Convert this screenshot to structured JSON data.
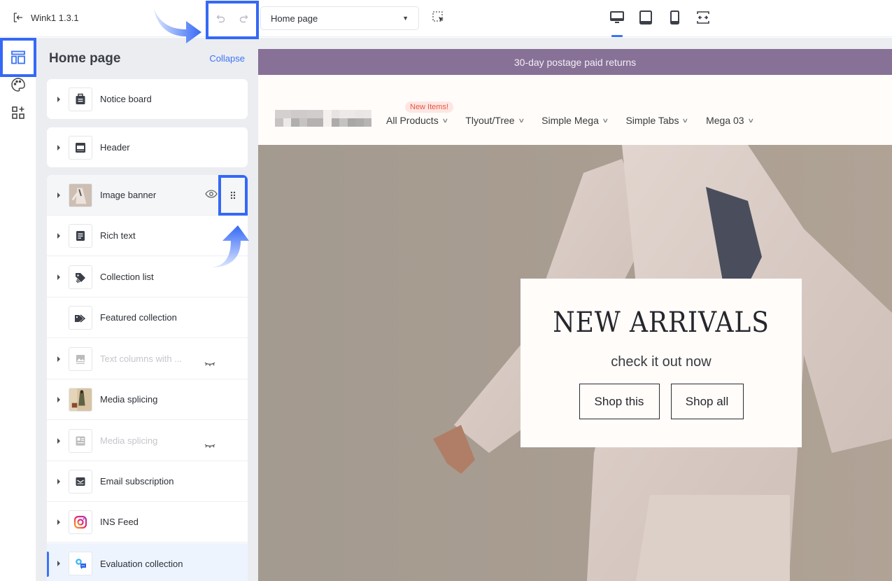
{
  "topbar": {
    "app_name": "Wink1 1.3.1",
    "exit_icon": "exit-icon",
    "undo_icon": "undo-icon",
    "redo_icon": "redo-icon",
    "page_select": {
      "selected": "Home page"
    },
    "select_tool_icon": "element-select-icon",
    "devices": [
      {
        "name": "desktop",
        "icon": "desktop-icon",
        "active": true
      },
      {
        "name": "tablet",
        "icon": "tablet-icon",
        "active": false
      },
      {
        "name": "mobile",
        "icon": "mobile-icon",
        "active": false
      },
      {
        "name": "fullwidth",
        "icon": "expand-width-icon",
        "active": false
      }
    ]
  },
  "rail": {
    "items": [
      {
        "name": "sections",
        "icon": "layout-icon",
        "active": true
      },
      {
        "name": "theme-settings",
        "icon": "palette-icon",
        "active": false
      },
      {
        "name": "apps",
        "icon": "add-block-icon",
        "active": false
      }
    ]
  },
  "sidebar": {
    "title": "Home page",
    "collapse_label": "Collapse",
    "sections": [
      {
        "label": "Notice board",
        "icon": "briefcase-icon",
        "visible": true,
        "expandable": true
      },
      {
        "label": "Header",
        "icon": "header-layout-icon",
        "visible": true,
        "expandable": true
      },
      {
        "label": "Image banner",
        "icon": "thumbnail-image",
        "visible": true,
        "expandable": true,
        "hovered": true
      },
      {
        "label": "Rich text",
        "icon": "document-icon",
        "visible": true,
        "expandable": true
      },
      {
        "label": "Collection list",
        "icon": "tags-icon",
        "visible": true,
        "expandable": true
      },
      {
        "label": "Featured collection",
        "icon": "tag-icon",
        "visible": true,
        "expandable": false
      },
      {
        "label": "Text columns with ...",
        "icon": "image-icon",
        "visible": false,
        "expandable": true
      },
      {
        "label": "Media splicing",
        "icon": "thumbnail-image",
        "visible": true,
        "expandable": true
      },
      {
        "label": "Media splicing",
        "icon": "media-card-icon",
        "visible": false,
        "expandable": true
      },
      {
        "label": "Email subscription",
        "icon": "mail-icon",
        "visible": true,
        "expandable": true
      },
      {
        "label": "INS Feed",
        "icon": "instagram-icon",
        "visible": true,
        "expandable": true
      },
      {
        "label": "Evaluation collection",
        "icon": "reviews-icon",
        "visible": true,
        "expandable": true,
        "selected": true
      }
    ]
  },
  "preview": {
    "announcement": "30-day postage paid returns",
    "nav": [
      {
        "label": "All Products",
        "badge": "New Items!"
      },
      {
        "label": "Tlyout/Tree"
      },
      {
        "label": "Simple Mega"
      },
      {
        "label": "Simple Tabs"
      },
      {
        "label": "Mega 03"
      }
    ],
    "banner": {
      "heading": "NEW ARRIVALS",
      "subheading": "check it out now",
      "buttons": [
        "Shop this",
        "Shop all"
      ]
    }
  },
  "colors": {
    "accent": "#3569f5",
    "announcement_bg": "#877196",
    "badge_text": "#e9553f",
    "badge_bg": "#fde6e3"
  }
}
